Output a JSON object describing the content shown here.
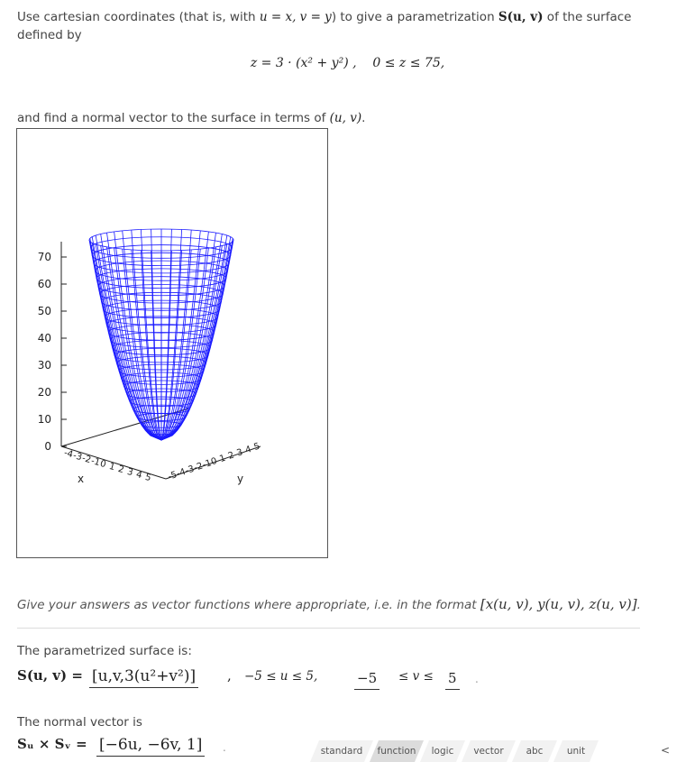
{
  "question": {
    "intro_1": "Use cartesian coordinates (that is, with ",
    "intro_math1": "u = x, v = y",
    "intro_2": ") to give a parametrization ",
    "intro_math2": "S(u, v)",
    "intro_3": " of the surface defined by",
    "equation_lhs": "z = 3 · (x² + y²) ,",
    "equation_rhs": "0 ≤ z ≤ 75,",
    "normal_text_1": "and find a normal vector to the surface in terms of ",
    "normal_text_math": "(u, v)",
    "normal_text_2": "."
  },
  "chart_data": {
    "type": "surface3d",
    "surface": "z = 3(x^2 + y^2)",
    "z_ticks": [
      "70",
      "60",
      "50",
      "40",
      "30",
      "20",
      "10",
      "0"
    ],
    "x_ticks": [
      "-4",
      "-3",
      "-2",
      "-1",
      "0",
      "1",
      "2",
      "3",
      "4",
      "5"
    ],
    "y_ticks": [
      "-5",
      "-4",
      "-3",
      "-2",
      "-1",
      "0",
      "1",
      "2",
      "3",
      "4",
      "5"
    ],
    "x_label_text": "x",
    "y_label_text": "y",
    "zlim": [
      0,
      75
    ],
    "mesh_color": "#1a1aff"
  },
  "hint": {
    "text": "Give your answers as vector functions where appropriate, i.e. in the format ",
    "format": "[x(u, v), y(u, v), z(u, v)]",
    "end": "."
  },
  "parametrized": {
    "label": "The parametrized surface is:",
    "lhs": "S(u, v) =",
    "answer": "[u,v,3(u²+v²)]",
    "comma": ",",
    "u_range": "−5 ≤ u ≤ 5,",
    "v_lower": "−5",
    "v_mid": "≤ v ≤",
    "v_upper": "5",
    "dot": "."
  },
  "normal": {
    "label": "The normal vector is",
    "lhs": "Sᵤ × Sᵥ =",
    "answer": "[−6u, −6v, 1]",
    "dot": "."
  },
  "keyboard_tabs": [
    {
      "label": "standard",
      "active": false
    },
    {
      "label": "function",
      "active": true
    },
    {
      "label": "logic",
      "active": false
    },
    {
      "label": "vector",
      "active": false
    },
    {
      "label": "abc",
      "active": false
    },
    {
      "label": "unit",
      "active": false
    }
  ],
  "chevron": "<"
}
